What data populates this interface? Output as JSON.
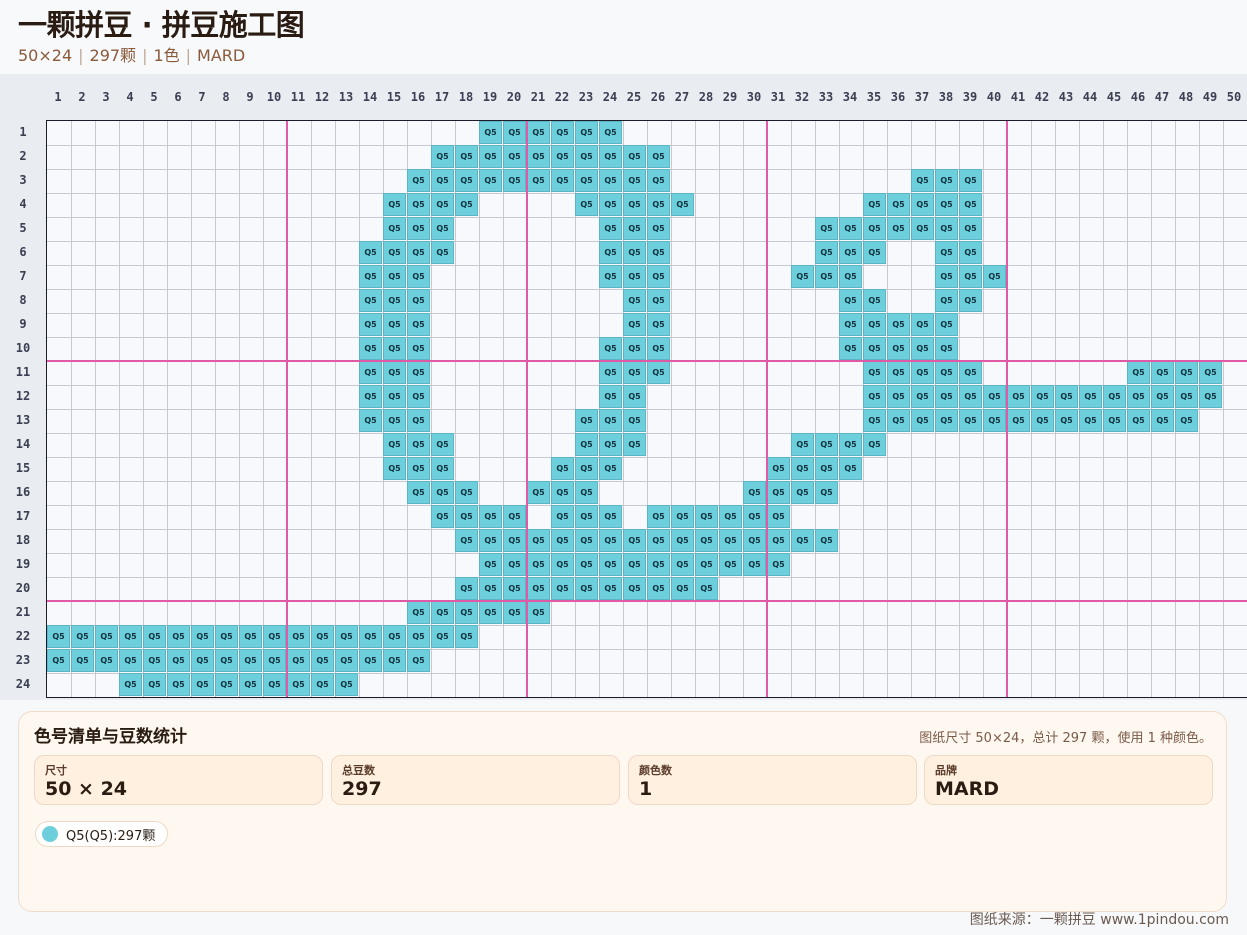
{
  "header": {
    "title": "一颗拼豆 · 拼豆施工图",
    "meta": [
      "50×24",
      "297颗",
      "1色",
      "MARD"
    ]
  },
  "colors": {
    "bead": "#6ecfdc",
    "bead_border": "#5bb5c5",
    "major_line": "#e05aa6"
  },
  "grid": {
    "columns": [
      "1",
      "2",
      "3",
      "4",
      "5",
      "6",
      "7",
      "8",
      "9",
      "10",
      "11",
      "12",
      "13",
      "14",
      "15",
      "16",
      "17",
      "18",
      "19",
      "20",
      "21",
      "22",
      "23",
      "24",
      "25",
      "26",
      "27",
      "28",
      "29",
      "30",
      "31",
      "32",
      "33",
      "34",
      "35",
      "36",
      "37",
      "38",
      "39",
      "40",
      "41",
      "42",
      "43",
      "44",
      "45",
      "46",
      "47",
      "48",
      "49",
      "50"
    ],
    "rows": [
      "1",
      "2",
      "3",
      "4",
      "5",
      "6",
      "7",
      "8",
      "9",
      "10",
      "11",
      "12",
      "13",
      "14",
      "15",
      "16",
      "17",
      "18",
      "19",
      "20",
      "21",
      "22",
      "23",
      "24"
    ],
    "major_every": 10,
    "bead_label": "Q5",
    "pattern": [
      "........................................................................................................",
      "..................######..........................",
      "................##########........................",
      "...............###########..........###...........",
      "..............####....#####.......#####...........",
      "..............###......###......#######...........",
      ".............####......###......###..##...........",
      ".............###.......###.....###...###..........",
      ".............###........##.......##..##...........",
      ".............###........##.......#####...........",
      ".............###.......###.......#####...........",
      ".............###.......###........#####......####",
      ".............###.......##.........###############",
      ".............###......###.........##############.",
      "..............###.....###......####..............",
      "..............###....###......####...............",
      "...............###..###......####................",
      "................####.###.######.................",
      ".................################...............",
      "..................#############.................",
      ".................###########....................",
      "...............######...........................",
      "##################..............................",
      "################................................",
      "...##########...................................."
    ]
  },
  "stats": {
    "title": "色号清单与豆数统计",
    "summary": "图纸尺寸 50×24，总计 297 颗，使用 1 种颜色。",
    "cards": [
      {
        "label": "尺寸",
        "value": "50 × 24"
      },
      {
        "label": "总豆数",
        "value": "297"
      },
      {
        "label": "颜色数",
        "value": "1"
      },
      {
        "label": "品牌",
        "value": "MARD"
      }
    ],
    "color_list": [
      {
        "text": "Q5(Q5):297颗"
      }
    ]
  },
  "footer": {
    "source": "图纸来源：一颗拼豆 www.1pindou.com"
  }
}
